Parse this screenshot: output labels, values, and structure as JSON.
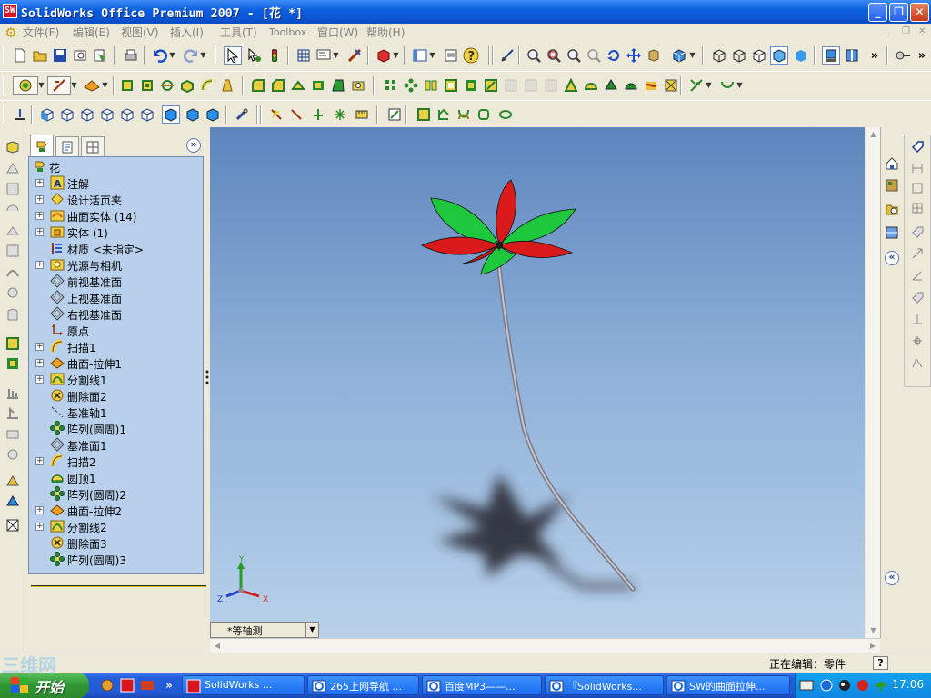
{
  "window": {
    "title": "SolidWorks Office Premium 2007 - [花 *]",
    "app_icon": "solidworks-logo-icon",
    "controls": [
      "minimize",
      "restore",
      "close"
    ]
  },
  "menubar": {
    "items": [
      "文件(F)",
      "编辑(E)",
      "视图(V)",
      "插入(I)",
      "工具(T)",
      "Toolbox",
      "窗口(W)",
      "帮助(H)"
    ]
  },
  "feature_manager": {
    "tabs": [
      "feature-tree-icon",
      "property-manager-icon",
      "configuration-manager-icon"
    ],
    "expand_label": "»",
    "root": "花",
    "items": [
      {
        "label": "注解",
        "icon": "annotations-icon",
        "expandable": true
      },
      {
        "label": "设计活页夹",
        "icon": "design-binder-icon",
        "expandable": true
      },
      {
        "label": "曲面实体 (14)",
        "icon": "surface-bodies-icon",
        "expandable": true
      },
      {
        "label": "实体 (1)",
        "icon": "solid-bodies-icon",
        "expandable": true
      },
      {
        "label": "材质 <未指定>",
        "icon": "material-icon",
        "expandable": false
      },
      {
        "label": "光源与相机",
        "icon": "lights-cameras-icon",
        "expandable": true
      },
      {
        "label": "前视基准面",
        "icon": "plane-icon",
        "expandable": false
      },
      {
        "label": "上视基准面",
        "icon": "plane-icon",
        "expandable": false
      },
      {
        "label": "右视基准面",
        "icon": "plane-icon",
        "expandable": false
      },
      {
        "label": "原点",
        "icon": "origin-icon",
        "expandable": false
      },
      {
        "label": "扫描1",
        "icon": "sweep-icon",
        "expandable": true
      },
      {
        "label": "曲面-拉伸1",
        "icon": "surface-extrude-icon",
        "expandable": true
      },
      {
        "label": "分割线1",
        "icon": "split-line-icon",
        "expandable": true
      },
      {
        "label": "删除面2",
        "icon": "delete-face-icon",
        "expandable": false
      },
      {
        "label": "基准轴1",
        "icon": "axis-icon",
        "expandable": false
      },
      {
        "label": "阵列(圆周)1",
        "icon": "circular-pattern-icon",
        "expandable": false
      },
      {
        "label": "基准面1",
        "icon": "plane-icon",
        "expandable": false
      },
      {
        "label": "扫描2",
        "icon": "sweep-icon",
        "expandable": true
      },
      {
        "label": "圆顶1",
        "icon": "dome-icon",
        "expandable": false
      },
      {
        "label": "阵列(圆周)2",
        "icon": "circular-pattern-icon",
        "expandable": false
      },
      {
        "label": "曲面-拉伸2",
        "icon": "surface-extrude-icon",
        "expandable": true
      },
      {
        "label": "分割线2",
        "icon": "split-line-icon",
        "expandable": true
      },
      {
        "label": "删除面3",
        "icon": "delete-face-icon",
        "expandable": false
      },
      {
        "label": "阵列(圆周)3",
        "icon": "circular-pattern-icon",
        "expandable": false
      }
    ]
  },
  "viewport": {
    "view_orientation": "*等轴测",
    "triad": {
      "x": "X",
      "y": "Y",
      "z": "Z"
    },
    "colors": {
      "petal_red": "#d81c1c",
      "petal_green": "#18c23a",
      "stem": "#9a9aa8"
    }
  },
  "statusbar": {
    "text": "正在编辑：零件",
    "help": "?"
  },
  "taskbar": {
    "start_label": "开始",
    "tasks": [
      {
        "label": "SolidWorks ...",
        "icon": "solidworks-logo-icon"
      },
      {
        "label": "265上网导航 ...",
        "icon": "ie-icon"
      },
      {
        "label": "百度MP3——...",
        "icon": "ie-icon"
      },
      {
        "label": "『SolidWorks...",
        "icon": "ie-icon"
      },
      {
        "label": "SW的曲面拉伸...",
        "icon": "ie-icon"
      }
    ],
    "clock": "17:06"
  },
  "watermark": "三维网"
}
